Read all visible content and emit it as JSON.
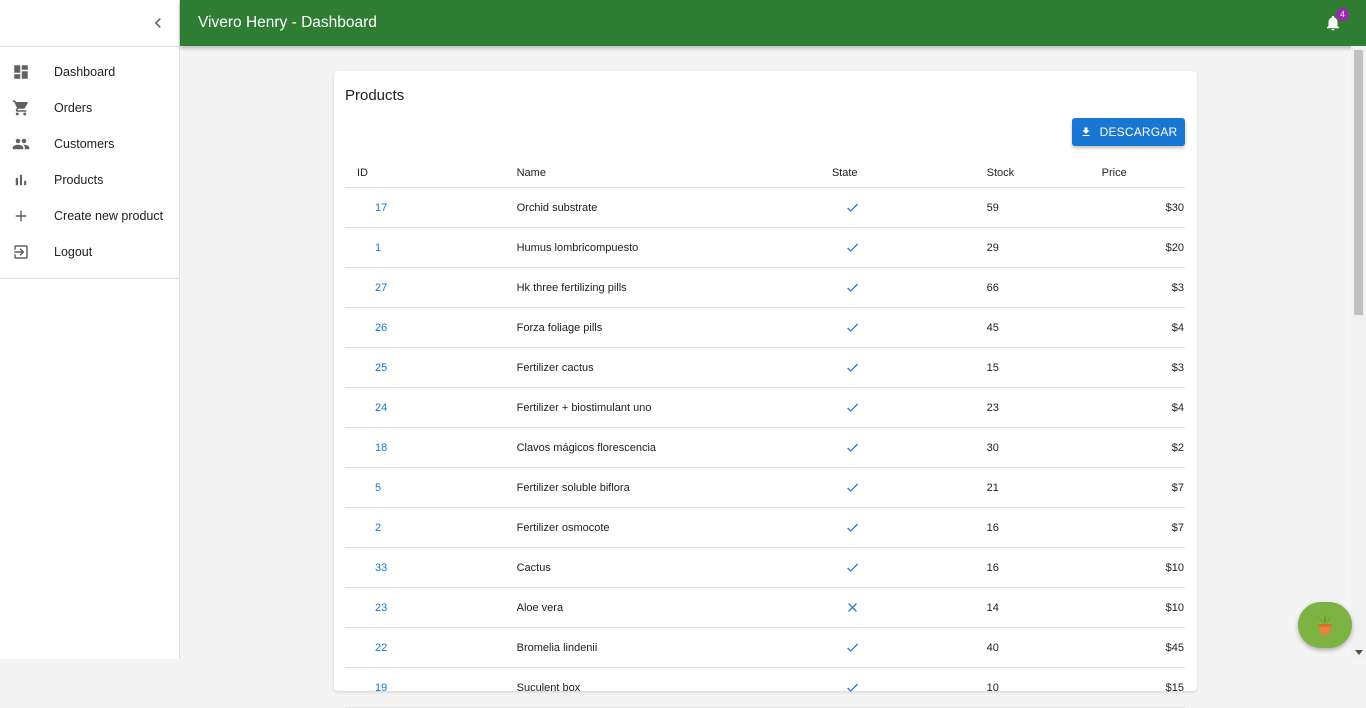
{
  "app": {
    "title": "Vivero Henry - Dashboard",
    "notification_count": "4"
  },
  "sidebar": {
    "items": [
      {
        "label": "Dashboard",
        "icon": "dashboard-icon"
      },
      {
        "label": "Orders",
        "icon": "cart-icon"
      },
      {
        "label": "Customers",
        "icon": "people-icon"
      },
      {
        "label": "Products",
        "icon": "bar-chart-icon"
      },
      {
        "label": "Create new product",
        "icon": "plus-icon"
      },
      {
        "label": "Logout",
        "icon": "logout-icon"
      }
    ]
  },
  "products": {
    "title": "Products",
    "download_label": "DESCARGAR",
    "columns": {
      "id": "ID",
      "name": "Name",
      "state": "State",
      "stock": "Stock",
      "price": "Price"
    },
    "rows": [
      {
        "id": "17",
        "name": "Orchid substrate",
        "state": true,
        "stock": "59",
        "price": "$30"
      },
      {
        "id": "1",
        "name": "Humus lombricompuesto",
        "state": true,
        "stock": "29",
        "price": "$20"
      },
      {
        "id": "27",
        "name": "Hk three fertilizing pills",
        "state": true,
        "stock": "66",
        "price": "$3"
      },
      {
        "id": "26",
        "name": "Forza foliage pills",
        "state": true,
        "stock": "45",
        "price": "$4"
      },
      {
        "id": "25",
        "name": "Fertilizer cactus",
        "state": true,
        "stock": "15",
        "price": "$3"
      },
      {
        "id": "24",
        "name": "Fertilizer + biostimulant uno",
        "state": true,
        "stock": "23",
        "price": "$4"
      },
      {
        "id": "18",
        "name": "Clavos mágicos florescencia",
        "state": true,
        "stock": "30",
        "price": "$2"
      },
      {
        "id": "5",
        "name": "Fertilizer soluble biflora",
        "state": true,
        "stock": "21",
        "price": "$7"
      },
      {
        "id": "2",
        "name": "Fertilizer osmocote",
        "state": true,
        "stock": "16",
        "price": "$7"
      },
      {
        "id": "33",
        "name": "Cactus",
        "state": true,
        "stock": "16",
        "price": "$10"
      },
      {
        "id": "23",
        "name": "Aloe vera",
        "state": false,
        "stock": "14",
        "price": "$10"
      },
      {
        "id": "22",
        "name": "Bromelia lindenii",
        "state": true,
        "stock": "40",
        "price": "$45"
      },
      {
        "id": "19",
        "name": "Suculent box",
        "state": true,
        "stock": "10",
        "price": "$15"
      }
    ]
  },
  "colors": {
    "appbar": "#2e7d32",
    "primary": "#1976d2",
    "badge": "#9c27b0",
    "fab": "#7cb342"
  }
}
